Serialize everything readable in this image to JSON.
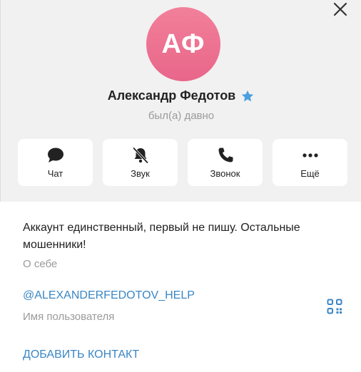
{
  "header": {
    "avatar_initials": "АФ",
    "name": "Александр Федотов",
    "status": "был(а) давно"
  },
  "actions": [
    {
      "label": "Чат",
      "icon": "chat-bubble-icon"
    },
    {
      "label": "Звук",
      "icon": "bell-muted-icon"
    },
    {
      "label": "Звонок",
      "icon": "phone-icon"
    },
    {
      "label": "Ещё",
      "icon": "more-dots-icon"
    }
  ],
  "info": {
    "bio": "Аккаунт единственный, первый не пишу. Остальные мошенники!",
    "bio_label": "О себе",
    "username": "@ALEXANDERFEDOTOV_HELP",
    "username_label": "Имя пользователя",
    "add_contact": "ДОБАВИТЬ КОНТАКТ"
  },
  "colors": {
    "avatar": "#ec7290",
    "link": "#3a86c4",
    "star": "#4a9fe0",
    "header_bg": "#f1f1f1"
  }
}
